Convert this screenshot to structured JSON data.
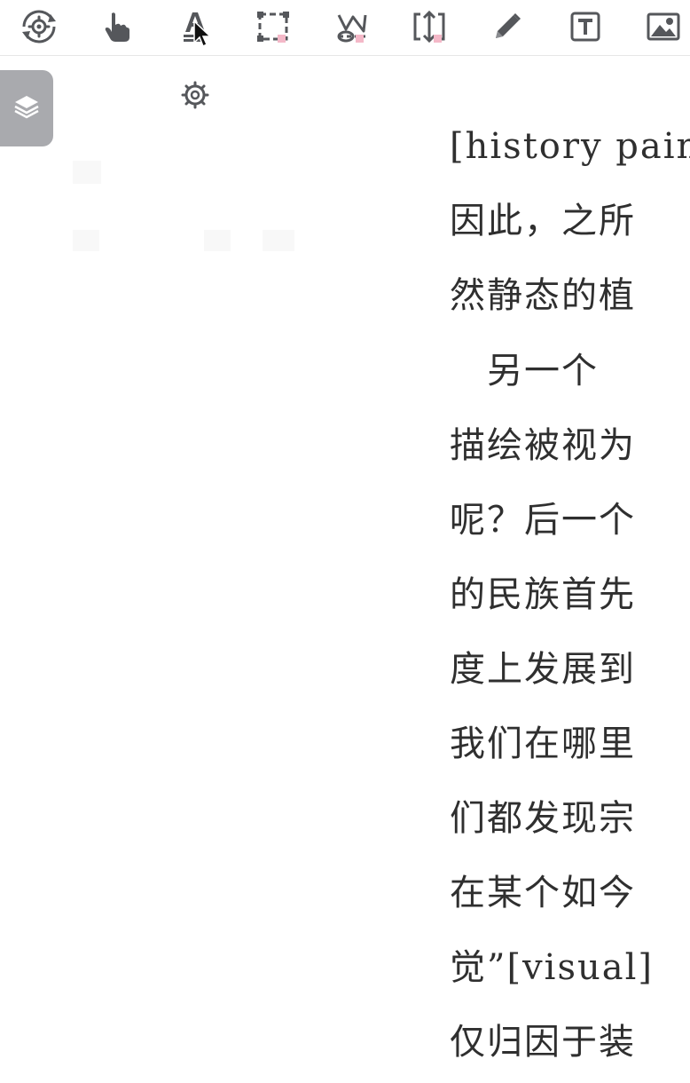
{
  "toolbar": {
    "tools": [
      {
        "name": "rotate-settings-tool",
        "icon": "rotate-gear-icon"
      },
      {
        "name": "pan-hand-tool",
        "icon": "hand-pointer-icon"
      },
      {
        "name": "text-select-tool",
        "icon": "text-select-icon"
      },
      {
        "name": "rectangle-select-tool",
        "icon": "rectangle-select-icon"
      },
      {
        "name": "freeform-select-tool",
        "icon": "lasso-icon"
      },
      {
        "name": "fit-resize-tool",
        "icon": "expand-arrows-icon"
      },
      {
        "name": "pencil-tool",
        "icon": "pencil-icon"
      },
      {
        "name": "text-box-tool",
        "icon": "text-box-icon"
      },
      {
        "name": "image-tool",
        "icon": "image-icon"
      }
    ],
    "icon_color": "#55575b",
    "marker_color": "#f4b8c8"
  },
  "sub_toolbar": {
    "icon": "gear-icon"
  },
  "layers_panel": {
    "icon": "layers-icon",
    "color": "#a9aaae"
  },
  "document": {
    "lines": [
      "[history pain",
      "因此，之所",
      "然静态的植",
      "　另一个",
      "描绘被视为",
      "呢？后一个",
      "的民族首先",
      "度上发展到",
      "我们在哪里",
      "们都发现宗",
      "在某个如今",
      "觉”[visual]",
      "仅归因于装"
    ]
  }
}
